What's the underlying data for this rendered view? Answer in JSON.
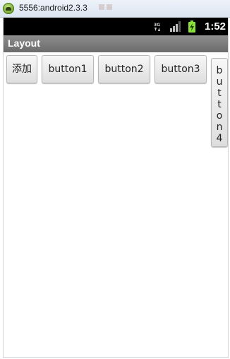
{
  "window": {
    "title": "5556:android2.3.3"
  },
  "status_bar": {
    "time": "1:52",
    "network_label": "3G",
    "icons": [
      "network-3g-icon",
      "signal-strength-icon",
      "battery-charging-icon"
    ]
  },
  "app_bar": {
    "title": "Layout"
  },
  "buttons": {
    "add": "添加",
    "button1": "button1",
    "button2": "button2",
    "button3": "button3",
    "button4": "button4"
  },
  "colors": {
    "status_bar": "#000000",
    "app_bar": "#7a7a7a",
    "battery": "#8be03c",
    "background": "#ffffff"
  }
}
